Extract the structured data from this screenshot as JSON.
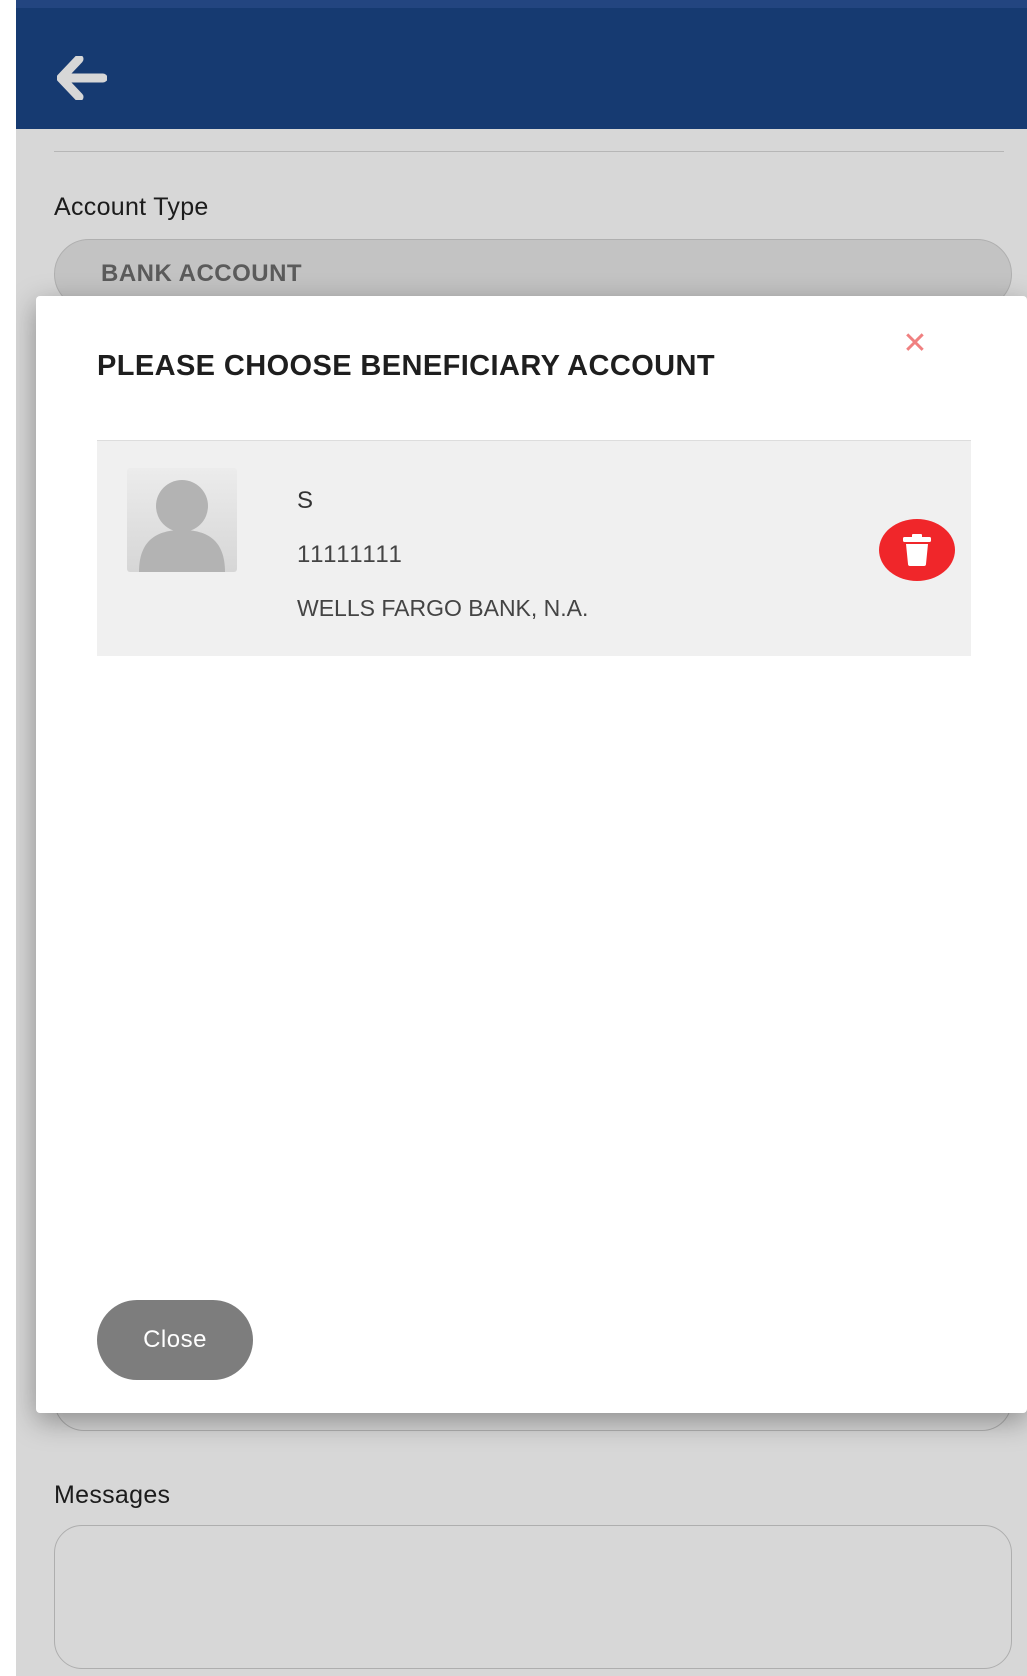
{
  "header": {
    "back_icon": "arrow-left-icon",
    "background_color": "#1b4587"
  },
  "form": {
    "account_type_label": "Account Type",
    "account_type_value": "BANK ACCOUNT",
    "messages_label": "Messages",
    "messages_value": ""
  },
  "modal": {
    "title": "PLEASE CHOOSE BENEFICIARY ACCOUNT",
    "close_icon": "close-icon",
    "close_icon_symbol": "✕",
    "beneficiaries": [
      {
        "name": "S",
        "account_number": "11111111",
        "bank": "WELLS FARGO BANK, N.A.",
        "avatar_icon": "user-avatar-icon",
        "delete_icon": "trash-icon"
      }
    ],
    "close_button_label": "Close",
    "delete_button_color": "#f0262a"
  }
}
